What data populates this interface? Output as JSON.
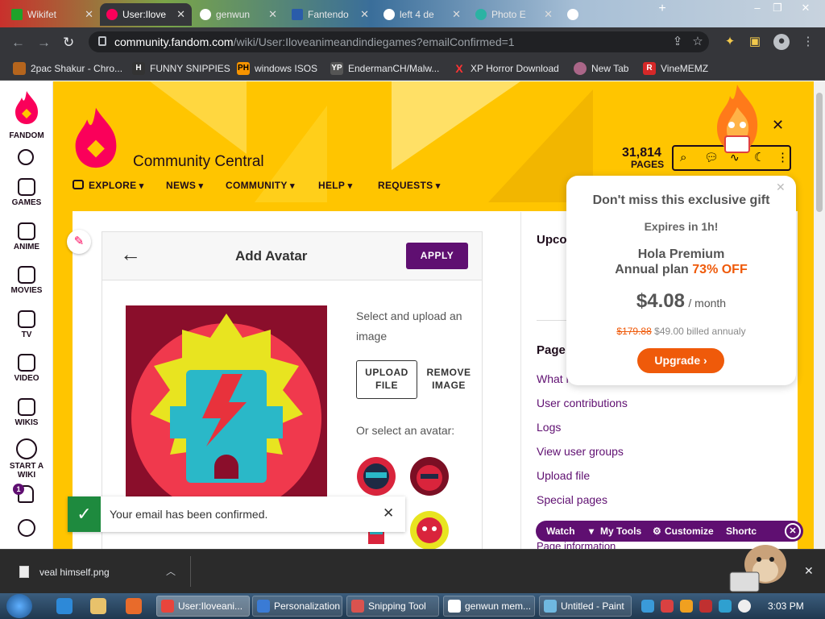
{
  "browser": {
    "tabs": [
      {
        "title": "Wikifet"
      },
      {
        "title": "User:Ilove"
      },
      {
        "title": "genwun"
      },
      {
        "title": "Fantendo"
      },
      {
        "title": "left 4 de"
      },
      {
        "title": "Photo E"
      },
      {
        "title": ""
      }
    ],
    "url_host": "community.fandom.com",
    "url_path": "/wiki/User:Iloveanimeandindiegames?emailConfirmed=1",
    "bookmarks": [
      {
        "label": "2pac Shakur - Chro...",
        "icon": "2pac-icon",
        "color": "#b5651d"
      },
      {
        "label": "FUNNY SNIPPIES",
        "icon": "h-icon",
        "color": "#333333"
      },
      {
        "label": "windows ISOS",
        "icon": "ph-icon",
        "color": "#f79400"
      },
      {
        "label": "EndermanCH/Malw...",
        "icon": "yp-icon",
        "color": "#666666"
      },
      {
        "label": "XP Horror Download",
        "icon": "x-icon",
        "color": "#d40000"
      },
      {
        "label": "New Tab",
        "icon": "newtab-icon",
        "color": "#aa6688"
      },
      {
        "label": "VineMEMZ",
        "icon": "r-icon",
        "color": "#d62828"
      }
    ]
  },
  "fandom_rail": {
    "logo_label": "FANDOM",
    "items": [
      {
        "label": "GAMES"
      },
      {
        "label": "ANIME"
      },
      {
        "label": "MOVIES"
      },
      {
        "label": "TV"
      },
      {
        "label": "VIDEO"
      },
      {
        "label": "WIKIS"
      },
      {
        "label": "START A WIKI"
      }
    ],
    "notification_count": "1"
  },
  "wiki": {
    "site_name": "Community Central",
    "page_count": "31,814",
    "page_count_label": "PAGES",
    "nav": [
      "EXPLORE",
      "NEWS",
      "COMMUNITY",
      "HELP",
      "REQUESTS"
    ]
  },
  "avatar_modal": {
    "title": "Add Avatar",
    "apply_label": "APPLY",
    "upload_prompt": "Select and upload an image",
    "upload_button": "UPLOAD FILE",
    "remove_button": "REMOVE IMAGE",
    "select_prompt": "Or select an avatar:"
  },
  "toast": {
    "message": "Your email has been confirmed."
  },
  "sidebar": {
    "upcoming_heading": "Upco",
    "pages_heading": "Page",
    "links": [
      "What l",
      "User contributions",
      "Logs",
      "View user groups",
      "Upload file",
      "Special pages",
      "Page information"
    ]
  },
  "promo": {
    "headline": "Don't miss this exclusive gift",
    "expires": "Expires in 1h!",
    "product_line1": "Hola Premium",
    "product_line2": "Annual plan",
    "discount": "73% OFF",
    "price": "$4.08",
    "per": "/ month",
    "old_price": "$179.88",
    "billed": "$49.00 billed annualy",
    "cta": "Upgrade ›"
  },
  "user_toolbar": {
    "items": [
      "Watch",
      "My Tools",
      "Customize",
      "Shortc"
    ]
  },
  "downloads": {
    "file": "veal himself.png"
  },
  "taskbar": {
    "windows": [
      "User:Iloveani...",
      "Personalization",
      "Snipping Tool",
      "genwun mem...",
      "Untitled - Paint"
    ],
    "clock": "3:03 PM"
  }
}
